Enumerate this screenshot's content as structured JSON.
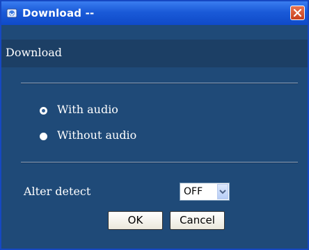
{
  "window": {
    "title": "Download --",
    "icon": "download-icon",
    "close_icon": "close-icon",
    "accent_color": "#1a5ad8",
    "close_color": "#d9582f"
  },
  "heading": "Download",
  "audio_options": [
    {
      "label": "With audio",
      "checked": true
    },
    {
      "label": "Without audio",
      "checked": false
    }
  ],
  "alert_detect": {
    "label": "Alter detect",
    "value": "OFF"
  },
  "buttons": {
    "ok": "OK",
    "cancel": "Cancel"
  },
  "colors": {
    "background": "#1f4a78",
    "heading_bar": "#1c3f65"
  }
}
